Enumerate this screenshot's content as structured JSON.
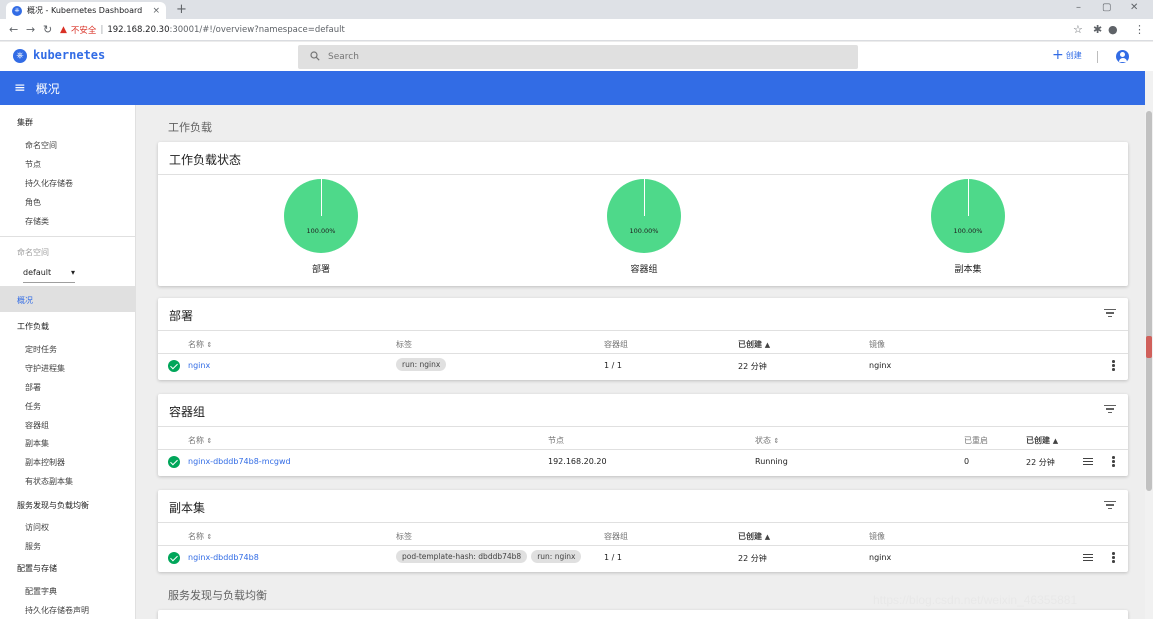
{
  "browser": {
    "tab_title": "概况 - Kubernetes Dashboard",
    "tab_close": "×",
    "new_tab": "+",
    "insecure_label": "不安全",
    "separator": "|",
    "url_host": "192.168.20.30",
    "url_rest": ":30001/#!/overview?namespace=default",
    "min": "–",
    "max": "▢",
    "close": "✕"
  },
  "header": {
    "brand": "kubernetes",
    "search_placeholder": "Search",
    "create_label": "创建",
    "create_plus": "+"
  },
  "titlebar": {
    "title": "概况",
    "menu": "≡"
  },
  "sidebar": {
    "cluster": "集群",
    "cluster_items": [
      "命名空间",
      "节点",
      "持久化存储卷",
      "角色",
      "存储类"
    ],
    "namespace_label": "命名空间",
    "namespace_value": "default",
    "overview": "概况",
    "workloads": "工作负载",
    "workload_items": [
      "定时任务",
      "守护进程集",
      "部署",
      "任务",
      "容器组",
      "副本集",
      "副本控制器",
      "有状态副本集"
    ],
    "discovery": "服务发现与负载均衡",
    "discovery_items": [
      "访问权",
      "服务"
    ],
    "config": "配置与存储",
    "config_items": [
      "配置字典",
      "持久化存储卷声明"
    ]
  },
  "main": {
    "workloads_title": "工作负载",
    "status_card": {
      "title": "工作负载状态",
      "pies": [
        {
          "label": "部署",
          "percent": "100.00%"
        },
        {
          "label": "容器组",
          "percent": "100.00%"
        },
        {
          "label": "副本集",
          "percent": "100.00%"
        }
      ]
    },
    "deployments": {
      "title": "部署",
      "headers": {
        "name": "名称",
        "labels": "标签",
        "pods": "容器组",
        "created": "已创建",
        "images": "镜像"
      },
      "rows": [
        {
          "name": "nginx",
          "labels": [
            "run: nginx"
          ],
          "pods": "1 / 1",
          "created": "22 分钟",
          "images": "nginx"
        }
      ]
    },
    "pods": {
      "title": "容器组",
      "headers": {
        "name": "名称",
        "node": "节点",
        "status": "状态",
        "restarts": "已重启",
        "created": "已创建"
      },
      "rows": [
        {
          "name": "nginx-dbddb74b8-mcgwd",
          "node": "192.168.20.20",
          "status": "Running",
          "restarts": "0",
          "created": "22 分钟"
        }
      ]
    },
    "replicasets": {
      "title": "副本集",
      "headers": {
        "name": "名称",
        "labels": "标签",
        "pods": "容器组",
        "created": "已创建",
        "images": "镜像"
      },
      "rows": [
        {
          "name": "nginx-dbddb74b8",
          "labels": [
            "pod-template-hash: dbddb74b8",
            "run: nginx"
          ],
          "pods": "1 / 1",
          "created": "22 分钟",
          "images": "nginx"
        }
      ]
    },
    "discovery_title": "服务发现与负载均衡"
  },
  "watermark": "https://blog.csdn.net/weixin_46355881",
  "colors": {
    "accent": "#326ce5",
    "pie": "#4ed98a",
    "ok": "#00a65a"
  }
}
